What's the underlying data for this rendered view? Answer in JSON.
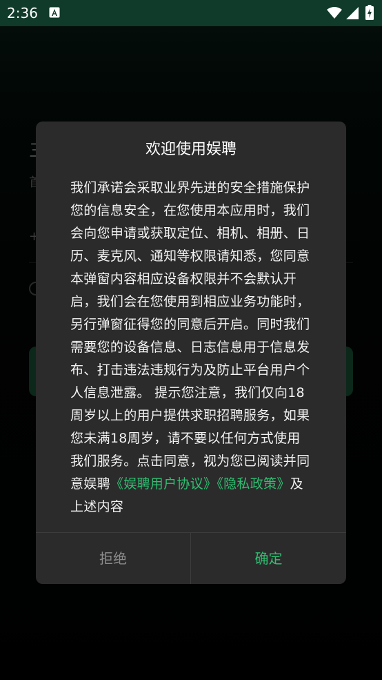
{
  "status_bar": {
    "time": "2:36",
    "icons": [
      "notification-a-icon",
      "wifi-icon",
      "signal-icon",
      "battery-charging-icon"
    ]
  },
  "background": {
    "title_fragment": "三",
    "subtitle_fragment": "首",
    "plus_label": "+"
  },
  "dialog": {
    "title": "欢迎使用娱聘",
    "body_text": "我们承诺会采取业界先进的安全措施保护您的信息安全，在您使用本应用时，我们会向您申请或获取定位、相机、相册、日历、麦克风、通知等权限请知悉，您同意本弹窗内容相应设备权限并不会默认开启，我们会在您使用到相应业务功能时，另行弹窗征得您的同意后开启。同时我们需要您的设备信息、日志信息用于信息发布、打击违法违规行为及防止平台用户个人信息泄露。 提示您注意，我们仅向18周岁以上的用户提供求职招聘服务，如果您未满18周岁，请不要以任何方式使用我们服务。点击同意，视为您已阅读并同意娱聘",
    "link_user_agreement": "《娱聘用户协议》",
    "link_privacy_policy": "《隐私政策》",
    "body_suffix": "及上述内容",
    "reject_label": "拒绝",
    "confirm_label": "确定"
  },
  "colors": {
    "accent_green": "#2fbf71",
    "dialog_bg": "#2b2b2b",
    "status_bar_bg": "#103a2a"
  }
}
